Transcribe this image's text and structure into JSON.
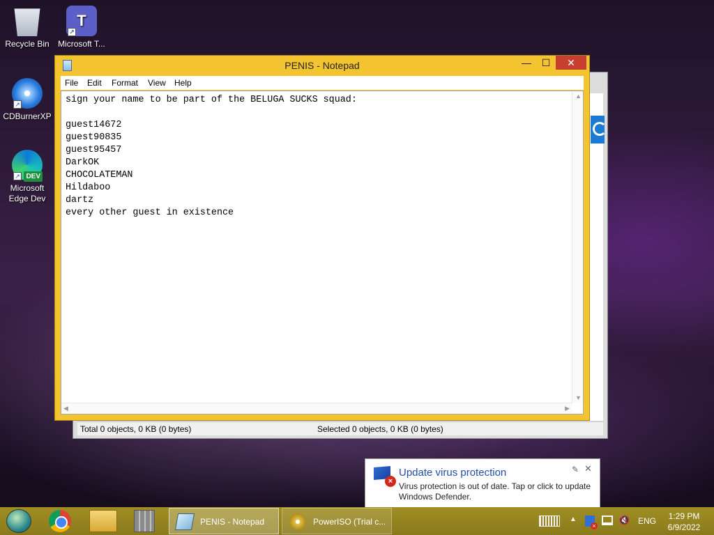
{
  "desktop": {
    "icons": [
      {
        "label": "Recycle Bin",
        "icon": "recycle-bin-icon"
      },
      {
        "label": "Microsoft T...",
        "icon": "teams-icon"
      },
      {
        "label": "CDBurnerXP",
        "icon": "cdburnerxp-icon"
      },
      {
        "label": "Microsoft Edge Dev",
        "icon": "edge-dev-icon",
        "badge": "DEV"
      }
    ]
  },
  "explorer_window": {
    "status_left": "Total 0 objects, 0 KB (0 bytes)",
    "status_right": "Selected 0 objects, 0 KB (0 bytes)"
  },
  "notepad": {
    "title": "PENIS - Notepad",
    "controls": {
      "minimize": "—",
      "maximize": "☐",
      "close": "✕"
    },
    "menu": [
      "File",
      "Edit",
      "Format",
      "View",
      "Help"
    ],
    "content": "sign your name to be part of the BELUGA SUCKS squad:\n\nguest14672\nguest90835\nguest95457\nDarkOK\nCHOCOLATEMAN\nHildaboo\ndartz\nevery other guest in existence"
  },
  "toast": {
    "title": "Update virus protection",
    "body": "Virus protection is out of date. Tap or click to update Windows Defender.",
    "icon": "windows-defender-flag-icon"
  },
  "taskbar": {
    "tasks": [
      {
        "label": "PENIS - Notepad",
        "active": true
      },
      {
        "label": "PowerISO (Trial c...",
        "active": false
      }
    ],
    "tray": {
      "language": "ENG",
      "time": "1:29 PM",
      "date": "6/9/2022"
    }
  },
  "colors": {
    "window_frame": "#f4c430",
    "close_button": "#c7402f",
    "taskbar": "#8a7a1c",
    "toast_title": "#1f4fa8"
  }
}
